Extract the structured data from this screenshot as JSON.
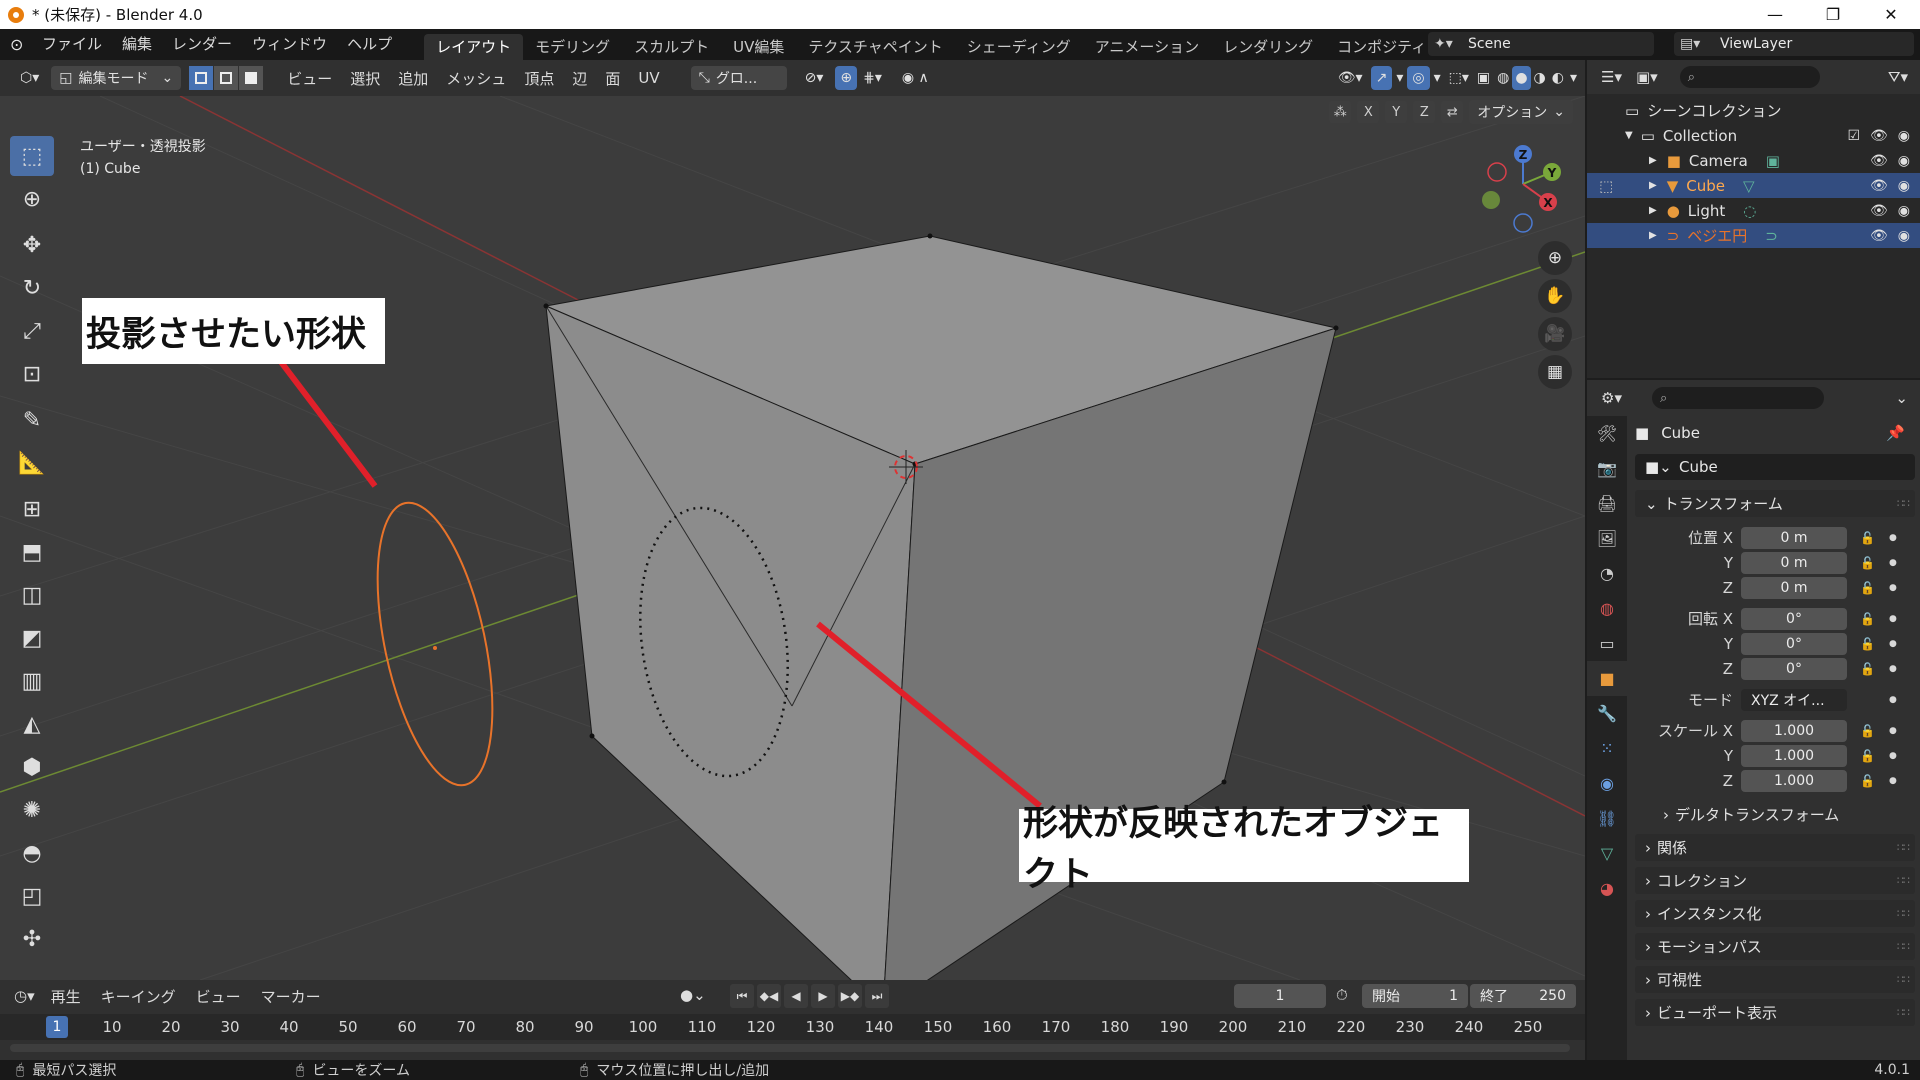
{
  "window": {
    "title": "* (未保存) - Blender 4.0",
    "buttons": [
      "—",
      "❐",
      "✕"
    ]
  },
  "topmenu": {
    "items": [
      "ファイル",
      "編集",
      "レンダー",
      "ウィンドウ",
      "ヘルプ"
    ],
    "workspaces": [
      "レイアウト",
      "モデリング",
      "スカルプト",
      "UV編集",
      "テクスチャペイント",
      "シェーディング",
      "アニメーション",
      "レンダリング",
      "コンポジティング"
    ],
    "active_workspace": "レイアウト",
    "scene": "Scene",
    "view_layer": "ViewLayer"
  },
  "viewport_header": {
    "mode": "編集モード",
    "menus": [
      "ビュー",
      "選択",
      "追加",
      "メッシュ",
      "頂点",
      "辺",
      "面",
      "UV"
    ],
    "transform_orientation": "グロ...",
    "options_label": "オプション",
    "axes": [
      "X",
      "Y",
      "Z"
    ]
  },
  "viewport": {
    "view_name": "ユーザー・透視投影",
    "object_name": "(1) Cube",
    "gizmo_labels": [
      "Z",
      "Y",
      "X"
    ]
  },
  "callouts": {
    "source": "投影させたい形状",
    "target": "形状が反映されたオブジェクト"
  },
  "outliner": {
    "root": "シーンコレクション",
    "collection": "Collection",
    "objects": [
      {
        "name": "Camera",
        "selected": false,
        "color": "#e2e2e2"
      },
      {
        "name": "Cube",
        "selected": true,
        "color": "#ffa94d"
      },
      {
        "name": "Light",
        "selected": false,
        "color": "#e2e2e2"
      },
      {
        "name": "ベジエ円",
        "selected": true,
        "color": "#e8732a"
      }
    ]
  },
  "properties": {
    "object_name": "Cube",
    "datablock": "Cube",
    "transform_label": "トランスフォーム",
    "location": {
      "label": "位置 X",
      "x": "0 m",
      "y": "0 m",
      "z": "0 m"
    },
    "rotation": {
      "label": "回転 X",
      "x": "0°",
      "y": "0°",
      "z": "0°"
    },
    "mode": {
      "label": "モード",
      "value": "XYZ オイ..."
    },
    "scale": {
      "label": "スケール X",
      "x": "1.000",
      "y": "1.000",
      "z": "1.000"
    },
    "axis_y": "Y",
    "axis_z": "Z",
    "delta_transform": "デルタトランスフォーム",
    "sections": [
      "関係",
      "コレクション",
      "インスタンス化",
      "モーションパス",
      "可視性",
      "ビューポート表示"
    ]
  },
  "timeline": {
    "menus": [
      "再生",
      "キーイング",
      "ビュー",
      "マーカー"
    ],
    "current_frame": "1",
    "start_label": "開始",
    "start": "1",
    "end_label": "終了",
    "end": "250",
    "ticks": [
      "10",
      "20",
      "30",
      "40",
      "50",
      "60",
      "70",
      "80",
      "90",
      "100",
      "110",
      "120",
      "130",
      "140",
      "150",
      "160",
      "170",
      "180",
      "190",
      "200",
      "210",
      "220",
      "230",
      "240",
      "250"
    ]
  },
  "statusbar": {
    "items": [
      "最短パス選択",
      "ビューをズーム",
      "マウス位置に押し出し/追加"
    ],
    "version": "4.0.1"
  },
  "colors": {
    "accent": "#4772b3",
    "selected_outline": "#ffa94d",
    "curve": "#e8732a",
    "annotation_red": "#e0202a"
  }
}
